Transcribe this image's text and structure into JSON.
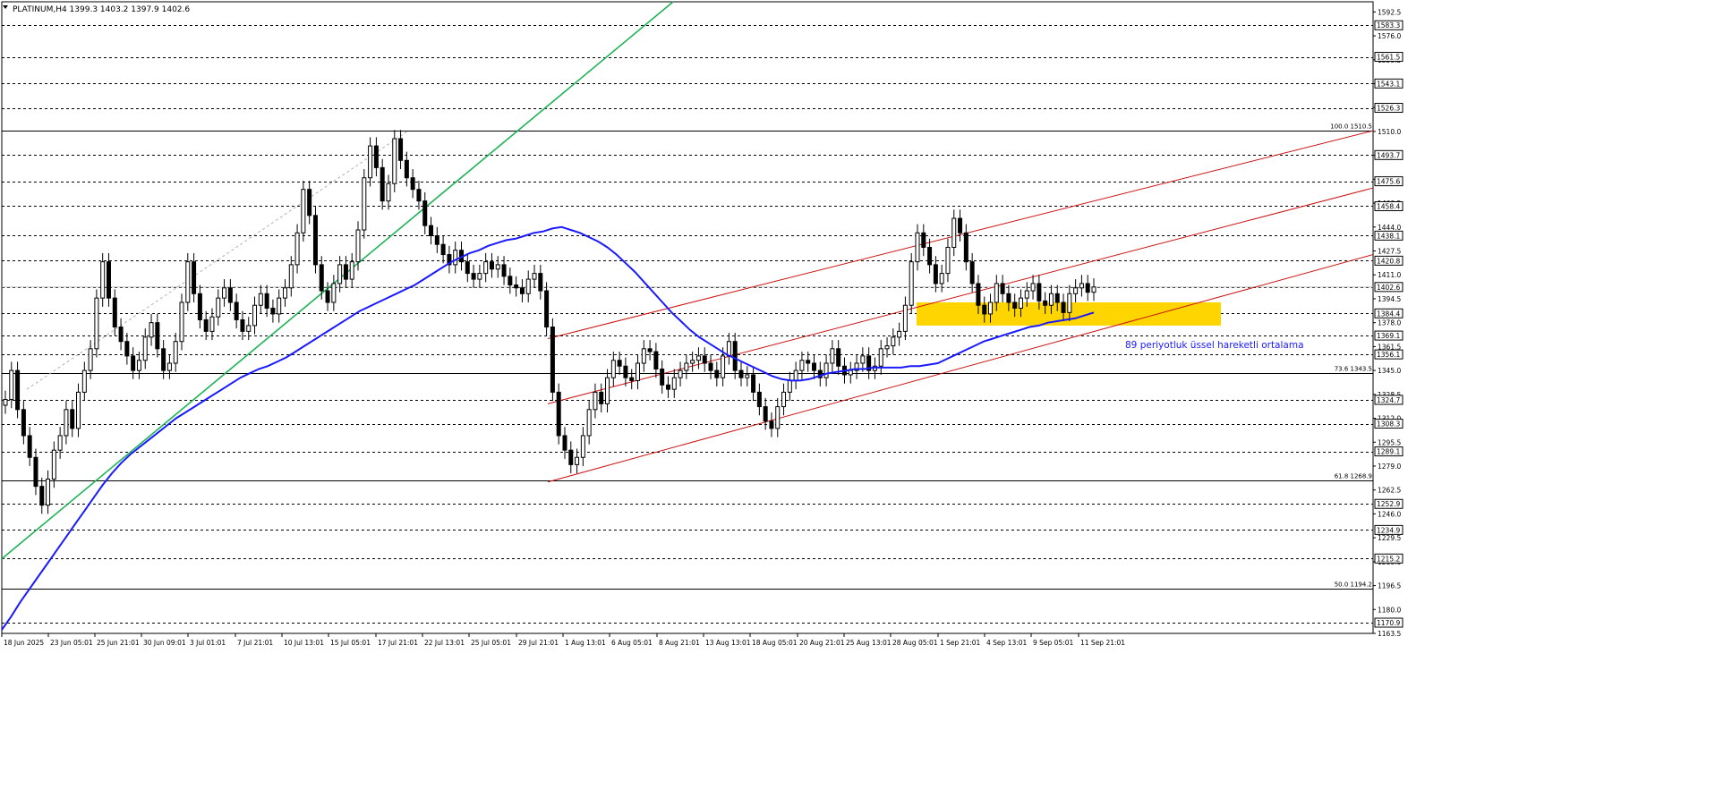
{
  "window": {
    "header": "PLATINUM,H4  1399.3 1403.2 1397.9 1402.6"
  },
  "chart_data": {
    "type": "line",
    "title": "PLATINUM,H4  1399.3 1403.2 1397.9 1402.6",
    "ohlc_last": {
      "open": 1399.3,
      "high": 1403.2,
      "low": 1397.9,
      "close": 1402.6
    },
    "ylim": [
      1163.5,
      1599.5
    ],
    "y_scale_labels": [
      1592.5,
      1576.0,
      1559.5,
      1543.0,
      1526.5,
      1510.0,
      1493.5,
      1477.0,
      1460.5,
      1444.0,
      1427.5,
      1411.0,
      1394.5,
      1378.0,
      1361.5,
      1345.0,
      1328.5,
      1312.0,
      1295.5,
      1279.0,
      1262.5,
      1246.0,
      1229.5,
      1213.0,
      1196.5,
      1180.0,
      1163.5
    ],
    "x_tick_labels": [
      "18 Jun 2025",
      "23 Jun 05:01",
      "25 Jun 21:01",
      "30 Jun 09:01",
      "3 Jul 01:01",
      "7 Jul 21:01",
      "10 Jul 13:01",
      "15 Jul 05:01",
      "17 Jul 21:01",
      "22 Jul 13:01",
      "25 Jul 05:01",
      "29 Jul 21:01",
      "1 Aug 13:01",
      "6 Aug 05:01",
      "8 Aug 21:01",
      "13 Aug 13:01",
      "18 Aug 05:01",
      "20 Aug 21:01",
      "25 Aug 13:01",
      "28 Aug 05:01",
      "1 Sep 21:01",
      "4 Sep 13:01",
      "9 Sep 05:01",
      "11 Sep 21:01"
    ],
    "horizontal_levels": [
      1583.3,
      1561.5,
      1543.1,
      1526.3,
      1493.7,
      1475.6,
      1458.4,
      1438.1,
      1420.8,
      1402.6,
      1384.4,
      1369.1,
      1356.1,
      1324.7,
      1308.3,
      1289.1,
      1252.9,
      1234.9,
      1215.2,
      1170.9
    ],
    "fibonacci_levels": [
      {
        "label": "100.0 1510.5",
        "value": 1510.5
      },
      {
        "label": "73.6 1343.5",
        "value": 1343.5
      },
      {
        "label": "61.8 1268.9",
        "value": 1268.9
      },
      {
        "label": "50.0 1194.2",
        "value": 1194.2
      }
    ],
    "annotation": "89 periyotluk üssel hareketli ortalama",
    "price_series_close": [
      1325,
      1345,
      1318,
      1300,
      1285,
      1265,
      1252,
      1270,
      1290,
      1300,
      1318,
      1305,
      1330,
      1345,
      1360,
      1395,
      1420,
      1395,
      1375,
      1365,
      1355,
      1345,
      1352,
      1368,
      1378,
      1360,
      1345,
      1350,
      1365,
      1392,
      1420,
      1398,
      1380,
      1372,
      1382,
      1395,
      1402,
      1392,
      1380,
      1372,
      1376,
      1390,
      1398,
      1388,
      1384,
      1395,
      1402,
      1418,
      1440,
      1470,
      1452,
      1418,
      1400,
      1392,
      1405,
      1418,
      1408,
      1420,
      1442,
      1478,
      1500,
      1485,
      1462,
      1474,
      1505,
      1490,
      1478,
      1470,
      1462,
      1445,
      1438,
      1432,
      1425,
      1418,
      1428,
      1420,
      1412,
      1408,
      1412,
      1420,
      1415,
      1418,
      1410,
      1404,
      1402,
      1398,
      1408,
      1412,
      1400,
      1375,
      1330,
      1300,
      1290,
      1280,
      1285,
      1300,
      1318,
      1330,
      1322,
      1340,
      1352,
      1348,
      1340,
      1338,
      1350,
      1360,
      1358,
      1346,
      1335,
      1332,
      1340,
      1345,
      1350,
      1352,
      1355,
      1350,
      1345,
      1340,
      1355,
      1365,
      1345,
      1340,
      1342,
      1330,
      1320,
      1310,
      1305,
      1320,
      1330,
      1338,
      1345,
      1352,
      1350,
      1345,
      1340,
      1350,
      1360,
      1348,
      1342,
      1345,
      1350,
      1355,
      1345,
      1348,
      1360,
      1362,
      1368,
      1372,
      1390,
      1420,
      1440,
      1430,
      1418,
      1405,
      1412,
      1430,
      1450,
      1440,
      1420,
      1405,
      1390,
      1384,
      1392,
      1405,
      1398,
      1392,
      1388,
      1395,
      1400,
      1405,
      1393,
      1390,
      1398,
      1392,
      1385,
      1398,
      1402,
      1405,
      1399,
      1402.6
    ],
    "ema_series": [
      1166,
      1175,
      1185,
      1194,
      1203,
      1212,
      1221,
      1230,
      1239,
      1248,
      1257,
      1266,
      1274,
      1281,
      1287,
      1292,
      1297,
      1302,
      1307,
      1312,
      1316,
      1320,
      1324,
      1328,
      1332,
      1336,
      1340,
      1343,
      1346,
      1348,
      1351,
      1354,
      1358,
      1362,
      1366,
      1370,
      1374,
      1378,
      1382,
      1386,
      1389,
      1392,
      1395,
      1398,
      1401,
      1404,
      1408,
      1412,
      1416,
      1420,
      1423,
      1426,
      1428,
      1431,
      1433,
      1435,
      1436,
      1438,
      1440,
      1441,
      1443,
      1444,
      1442,
      1440,
      1437,
      1434,
      1430,
      1425,
      1419,
      1413,
      1406,
      1399,
      1392,
      1385,
      1379,
      1373,
      1368,
      1364,
      1360,
      1356,
      1353,
      1350,
      1347,
      1344,
      1341,
      1339,
      1338,
      1338,
      1339,
      1341,
      1343,
      1344,
      1345,
      1346,
      1346,
      1347,
      1347,
      1347,
      1347,
      1348,
      1348,
      1349,
      1350,
      1353,
      1356,
      1359,
      1362,
      1365,
      1367,
      1369,
      1371,
      1373,
      1375,
      1376,
      1378,
      1379,
      1380,
      1381,
      1383,
      1385
    ],
    "trendlines": {
      "green_support": "rising line from lower-left through late-July breakdown",
      "red_channel": "three parallel rising red lines"
    },
    "highlight_zone": {
      "from": 1376.0,
      "to": 1392.0,
      "color": "#FFD500"
    },
    "colors": {
      "background": "#FFFFFF",
      "candles": "#000000",
      "ema": "#1A1AFF",
      "green_trendline": "#1DB356",
      "red_channel": "#CC1414",
      "annotation": "#1A1AFF",
      "zone": "#FFD500",
      "grid_dash": "#000000"
    }
  }
}
